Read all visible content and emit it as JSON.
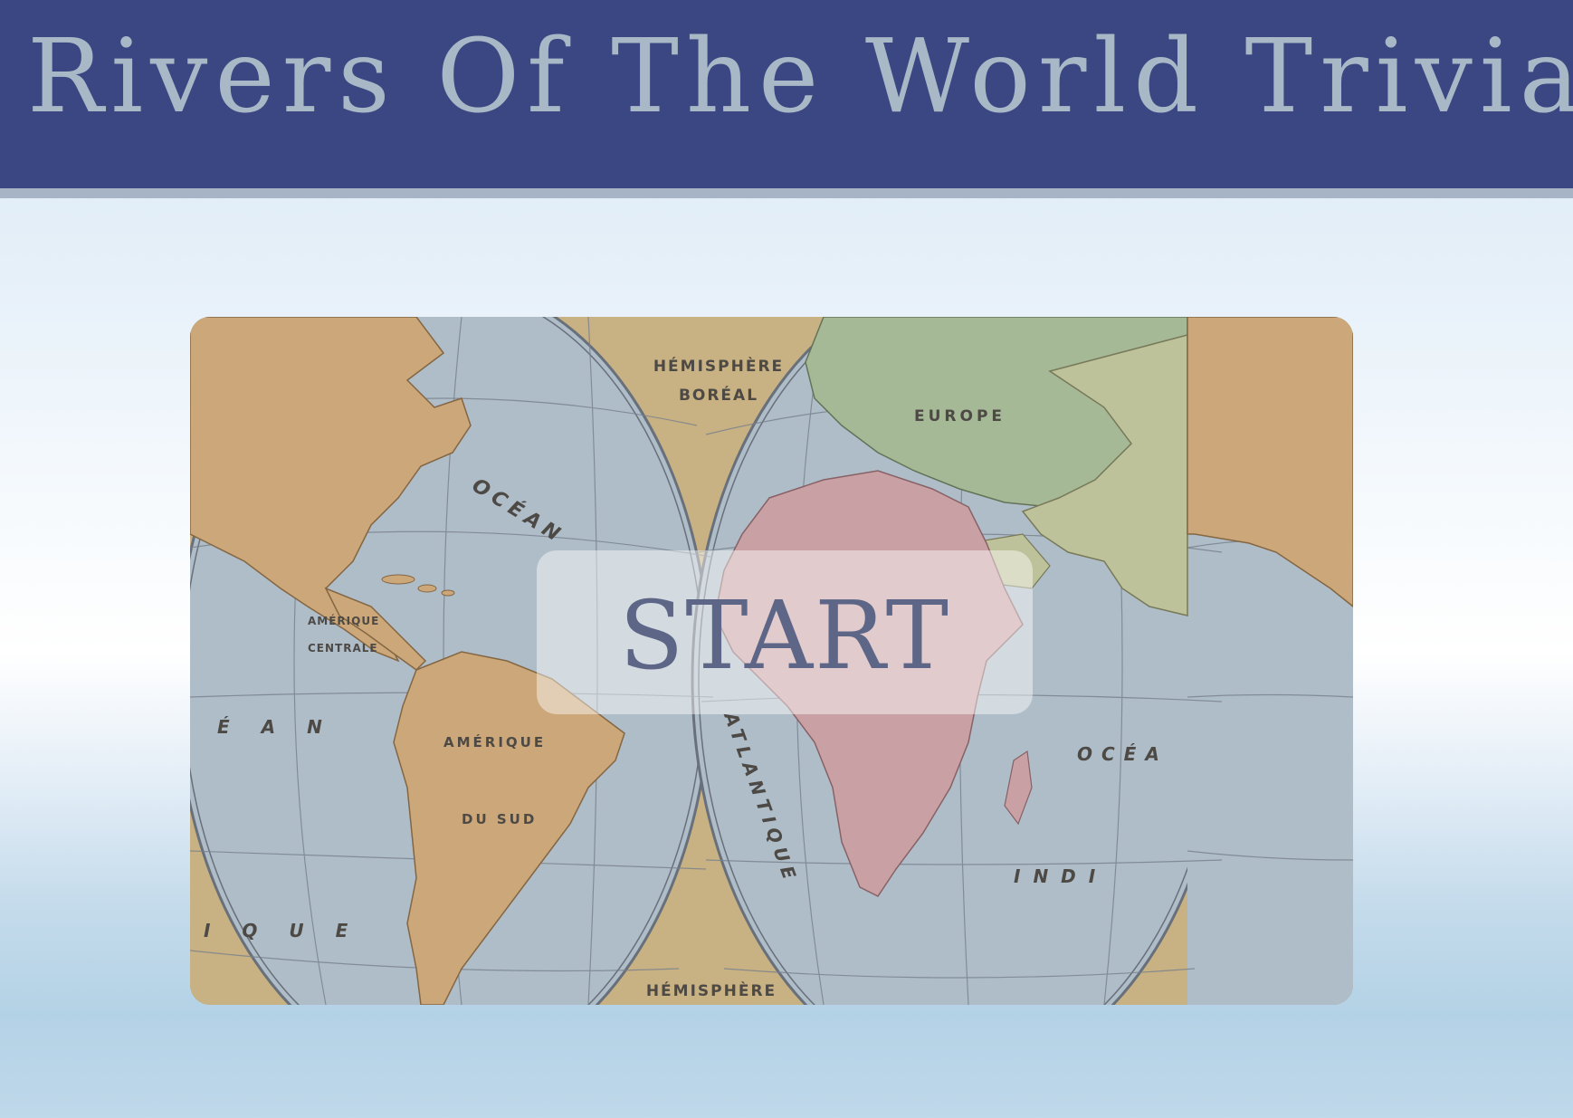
{
  "header": {
    "title": "Rivers Of The World Trivia"
  },
  "map": {
    "labels": {
      "hemisphere_north_line1": "HÉMISPHÈRE",
      "hemisphere_north_line2": "BORÉAL",
      "hemisphere_south": "HÉMISPHÈRE",
      "europe": "EUROPE",
      "amerique_sud_line1": "AMÉRIQUE",
      "amerique_sud_line2": "DU SUD",
      "amerique_centrale_line1": "AMÉRIQUE",
      "amerique_centrale_line2": "CENTRALE",
      "ocean_west": "OCÉAN",
      "atlantique": "ATLANTIQUE",
      "ocean_indien_line1": "OCÉA",
      "ocean_indien_line2": "INDI",
      "ocean_left_fragment": "É A N",
      "ique_fragment": "I Q U E"
    }
  },
  "start_button": {
    "label": "START"
  },
  "colors": {
    "header_bg": "#3b4782",
    "header_border": "#a7b4c6",
    "title_text": "#a8b8c6",
    "ocean": "#a9b8c4",
    "land_americas": "#c7a06e",
    "land_africa": "#c59a9e",
    "land_europe": "#9fb38e",
    "land_asia": "#b9bd92",
    "map_bg": "#c4ab79",
    "start_text": "#5e6688"
  }
}
